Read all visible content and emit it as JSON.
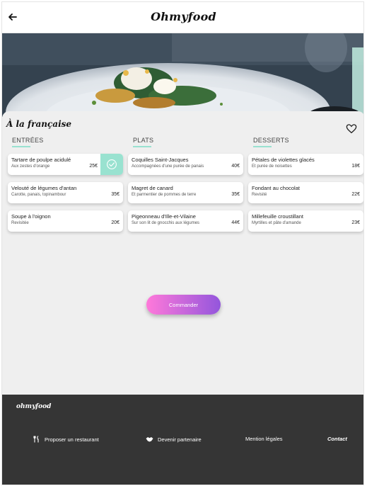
{
  "header": {
    "back_icon": "arrow-left-icon",
    "logo": "Ohmyfood"
  },
  "restaurant": {
    "title": "À la française",
    "favorite_icon": "heart-outline-icon"
  },
  "columns": [
    {
      "title": "ENTRÉES",
      "dishes": [
        {
          "name": "Tartare de poulpe acidulé",
          "desc": "Aux zestes d'orange",
          "price": "25€",
          "selected": true
        },
        {
          "name": "Velouté de légumes d'antan",
          "desc": "Carotte, panais, topinambour",
          "price": "35€"
        },
        {
          "name": "Soupe à l'oignon",
          "desc": "Revisitée",
          "price": "20€"
        }
      ]
    },
    {
      "title": "PLATS",
      "dishes": [
        {
          "name": "Coquilles Saint-Jacques",
          "desc": "Accompagnées d'une purée de panais",
          "price": "40€"
        },
        {
          "name": "Magret de canard",
          "desc": "Et parmentier de pommes de terre",
          "price": "35€"
        },
        {
          "name": "Pigeonneau d'Ille-et-Vilaine",
          "desc": "Sur son lit de gnocchis aux légumes",
          "price": "44€"
        }
      ]
    },
    {
      "title": "DESSERTS",
      "dishes": [
        {
          "name": "Pétales de violettes glacés",
          "desc": "Et purée de noisettes",
          "price": "18€"
        },
        {
          "name": "Fondant au chocolat",
          "desc": "Revisité",
          "price": "22€"
        },
        {
          "name": "Millefeuille croustillant",
          "desc": "Myrtilles et pâte d'amande",
          "price": "23€"
        }
      ]
    }
  ],
  "order_button": "Commander",
  "footer": {
    "logo": "ohmyfood",
    "links": [
      {
        "label": "Proposer un restaurant",
        "icon": "utensils-icon"
      },
      {
        "label": "Devenir partenaire",
        "icon": "handshake-icon"
      },
      {
        "label": "Mention légales"
      },
      {
        "label": "Contact"
      }
    ]
  },
  "colors": {
    "accent_mint": "#99e2d0",
    "button_gradient_start": "#ff79da",
    "button_gradient_end": "#9356dc",
    "footer_bg": "#353535",
    "page_bg": "#efefef"
  }
}
